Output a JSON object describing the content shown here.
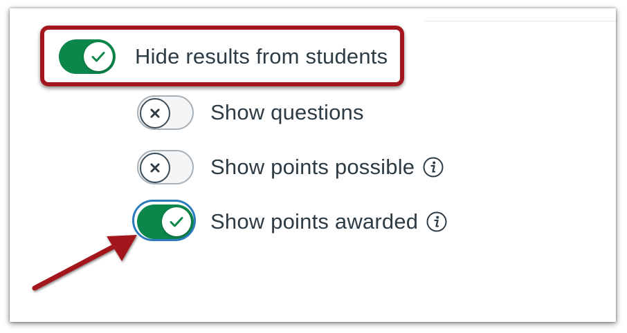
{
  "options": [
    {
      "label": "Hide results from students",
      "state": "on",
      "info": false
    },
    {
      "label": "Show questions",
      "state": "off",
      "info": false
    },
    {
      "label": "Show points possible",
      "state": "off",
      "info": true
    },
    {
      "label": "Show points awarded",
      "state": "on",
      "info": true
    }
  ],
  "colors": {
    "toggle_on": "#0b874b",
    "toggle_off_border": "#a7b0b7",
    "focus_ring": "#2b7abc",
    "annotation_red": "#a3161d",
    "label_text": "#2d3b45"
  },
  "icons": {
    "check": "check-icon",
    "x": "x-icon",
    "info": "info-icon"
  }
}
